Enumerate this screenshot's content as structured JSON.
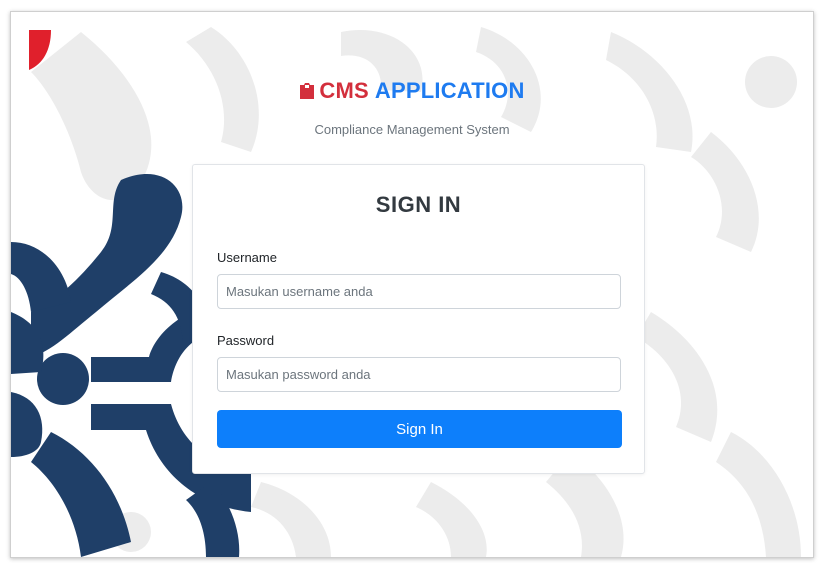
{
  "brand": {
    "logo_icon": "folder-icon",
    "name_part1": "CMS",
    "name_part2": "APPLICATION",
    "subtitle": "Compliance Management System"
  },
  "form": {
    "title": "SIGN IN",
    "username_label": "Username",
    "username_placeholder": "Masukan username anda",
    "username_value": "",
    "password_label": "Password",
    "password_placeholder": "Masukan password anda",
    "password_value": "",
    "submit_label": "Sign In"
  },
  "colors": {
    "brand_red": "#d32f3c",
    "brand_blue": "#1e7bf0",
    "button_blue": "#0d7ffb",
    "navy_pattern": "#1f3f68"
  }
}
